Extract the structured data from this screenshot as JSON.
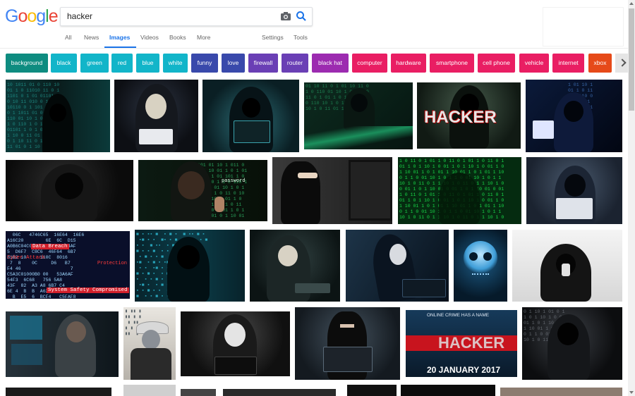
{
  "search": {
    "query": "hacker"
  },
  "logo": {
    "letters": [
      "G",
      "o",
      "o",
      "g",
      "l",
      "e"
    ],
    "colors": [
      "#4285f4",
      "#ea4335",
      "#fbbc05",
      "#4285f4",
      "#34a853",
      "#ea4335"
    ]
  },
  "tabs": [
    {
      "label": "All"
    },
    {
      "label": "News"
    },
    {
      "label": "Images",
      "active": true
    },
    {
      "label": "Videos"
    },
    {
      "label": "Books"
    },
    {
      "label": "More"
    },
    {
      "label": "Settings"
    },
    {
      "label": "Tools"
    }
  ],
  "chips": [
    {
      "label": "background",
      "color": "#0e8c80"
    },
    {
      "label": "black",
      "color": "#12b5c9"
    },
    {
      "label": "green",
      "color": "#12b5c9"
    },
    {
      "label": "red",
      "color": "#12b5c9"
    },
    {
      "label": "blue",
      "color": "#12b5c9"
    },
    {
      "label": "white",
      "color": "#12b5c9"
    },
    {
      "label": "funny",
      "color": "#3949ab"
    },
    {
      "label": "love",
      "color": "#3949ab"
    },
    {
      "label": "firewall",
      "color": "#6a3fb5"
    },
    {
      "label": "router",
      "color": "#6a3fb5"
    },
    {
      "label": "black hat",
      "color": "#9c2bb0"
    },
    {
      "label": "computer",
      "color": "#e91e63"
    },
    {
      "label": "hardware",
      "color": "#e91e63"
    },
    {
      "label": "smartphone",
      "color": "#e91e63"
    },
    {
      "label": "cell phone",
      "color": "#e91e63"
    },
    {
      "label": "vehicle",
      "color": "#e91e63"
    },
    {
      "label": "internet",
      "color": "#e91e63"
    },
    {
      "label": "xbox",
      "color": "#e64a19"
    }
  ],
  "image_text": {
    "hacker_banner": "HACKER",
    "password": "password",
    "data_breach": "Data Breach",
    "cyber_attack": "Cyber Attack",
    "protection": "Protection",
    "system_safety": "System Safety Compromised",
    "online_name": "ONLINE CRIME HAS A NAME",
    "hacker_red": "HACKER",
    "date": "20 JANUARY 2017"
  }
}
